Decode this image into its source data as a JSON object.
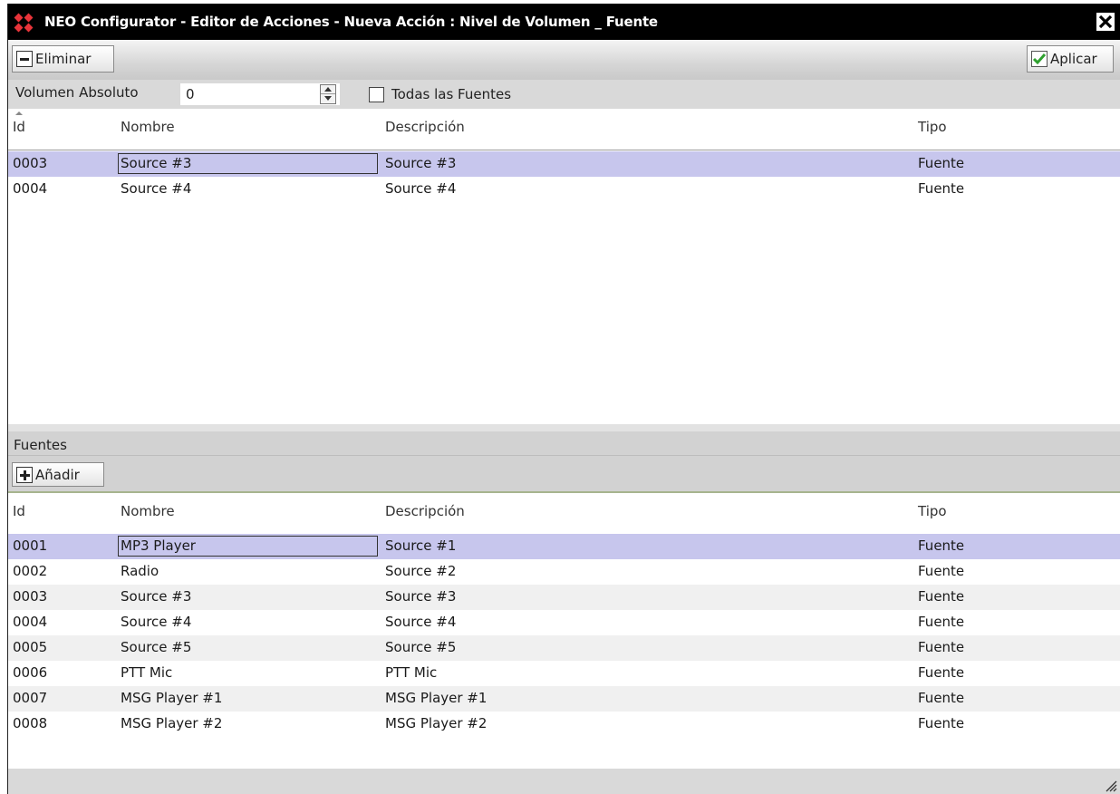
{
  "window": {
    "title": "NEO Configurator - Editor de Acciones - Nueva Acción : Nivel de Volumen _ Fuente",
    "accent_color": "#c7c6ed"
  },
  "toolbar": {
    "remove_label": "Eliminar",
    "apply_label": "Aplicar"
  },
  "params": {
    "volume_label": "Volumen Absoluto",
    "volume_value": "0",
    "all_sources_label": "Todas las Fuentes",
    "all_sources_checked": false
  },
  "columns": {
    "id": "Id",
    "name": "Nombre",
    "description": "Descripción",
    "type": "Tipo"
  },
  "selected": [
    {
      "id": "0003",
      "name": "Source #3",
      "description": "Source #3",
      "type": "Fuente"
    },
    {
      "id": "0004",
      "name": "Source #4",
      "description": "Source #4",
      "type": "Fuente"
    }
  ],
  "sources_section": {
    "title": "Fuentes",
    "add_label": "Añadir"
  },
  "sources": [
    {
      "id": "0001",
      "name": "MP3 Player",
      "description": "Source #1",
      "type": "Fuente"
    },
    {
      "id": "0002",
      "name": "Radio",
      "description": "Source #2",
      "type": "Fuente"
    },
    {
      "id": "0003",
      "name": "Source #3",
      "description": "Source #3",
      "type": "Fuente"
    },
    {
      "id": "0004",
      "name": "Source #4",
      "description": "Source #4",
      "type": "Fuente"
    },
    {
      "id": "0005",
      "name": "Source #5",
      "description": "Source #5",
      "type": "Fuente"
    },
    {
      "id": "0006",
      "name": "PTT Mic",
      "description": "PTT Mic",
      "type": "Fuente"
    },
    {
      "id": "0007",
      "name": "MSG Player #1",
      "description": "MSG Player #1",
      "type": "Fuente"
    },
    {
      "id": "0008",
      "name": "MSG Player #2",
      "description": "MSG Player #2",
      "type": "Fuente"
    }
  ]
}
